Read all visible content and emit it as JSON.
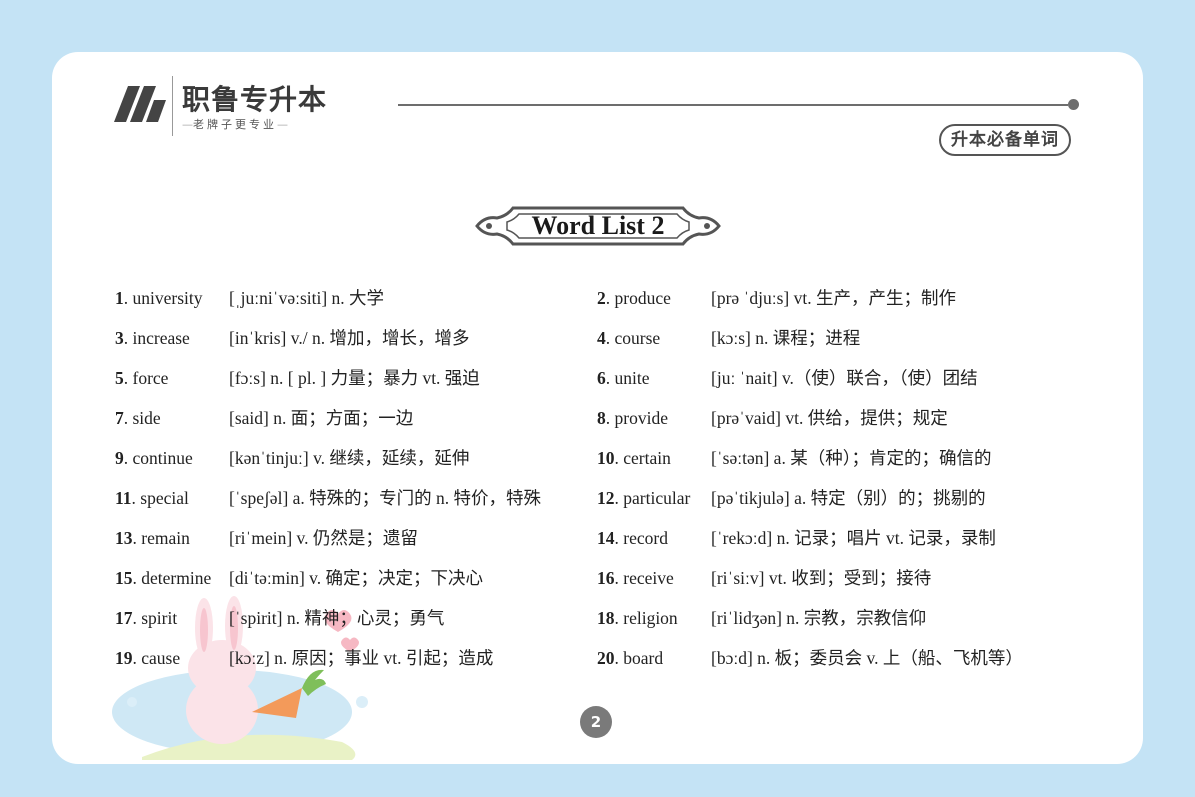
{
  "header": {
    "brand_name": "职鲁专升本",
    "slogan": "老牌子更专业",
    "tag": "升本必备单词"
  },
  "title": "Word List 2",
  "page_number": "2",
  "colors": {
    "background": "#c4e3f5",
    "card": "#ffffff",
    "text": "#222222"
  },
  "entries": [
    {
      "num": "1",
      "word": "university",
      "def": "[ˌjuːniˈvəːsiti]  n. 大学"
    },
    {
      "num": "2",
      "word": "produce",
      "def": "[prə ˈdjuːs]  vt. 生产，产生；制作"
    },
    {
      "num": "3",
      "word": "increase",
      "def": "[inˈkris]  v./ n. 增加，增长，增多"
    },
    {
      "num": "4",
      "word": "course",
      "def": "[kɔːs]  n. 课程；进程"
    },
    {
      "num": "5",
      "word": "force",
      "def": "[fɔːs]  n. [ pl. ] 力量；暴力  vt. 强迫"
    },
    {
      "num": "6",
      "word": "unite",
      "def": "[juː ˈnait]  v.（使）联合，（使）团结"
    },
    {
      "num": "7",
      "word": "side",
      "def": "[said]  n. 面；方面；一边"
    },
    {
      "num": "8",
      "word": "provide",
      "def": "[prəˈvaid]  vt. 供给，提供；规定"
    },
    {
      "num": "9",
      "word": "continue",
      "def": "[kənˈtinjuː]  v. 继续，延续，延伸"
    },
    {
      "num": "10",
      "word": "certain",
      "def": "[ˈsəːtən]  a. 某（种）；肯定的；确信的"
    },
    {
      "num": "11",
      "word": "special",
      "def": "[ˈspeʃəl]  a. 特殊的；专门的  n. 特价，特殊"
    },
    {
      "num": "12",
      "word": "particular",
      "def": "[pəˈtikjulə]  a. 特定（别）的；挑剔的"
    },
    {
      "num": "13",
      "word": "remain",
      "def": "[riˈmein]  v. 仍然是；遗留"
    },
    {
      "num": "14",
      "word": "record",
      "def": "[ˈrekɔːd]  n. 记录；唱片  vt. 记录，录制"
    },
    {
      "num": "15",
      "word": "determine",
      "def": "[diˈtəːmin]  v. 确定；决定；下决心"
    },
    {
      "num": "16",
      "word": "receive",
      "def": "[riˈsiːv]  vt. 收到；受到；接待"
    },
    {
      "num": "17",
      "word": "spirit",
      "def": "[ˈspirit]  n. 精神；心灵；勇气"
    },
    {
      "num": "18",
      "word": "religion",
      "def": "[riˈlidʒən]  n. 宗教，宗教信仰"
    },
    {
      "num": "19",
      "word": "cause",
      "def": "[kɔːz]  n. 原因；事业  vt. 引起；造成"
    },
    {
      "num": "20",
      "word": "board",
      "def": "[bɔːd]  n. 板；委员会  v. 上（船、飞机等）"
    }
  ]
}
